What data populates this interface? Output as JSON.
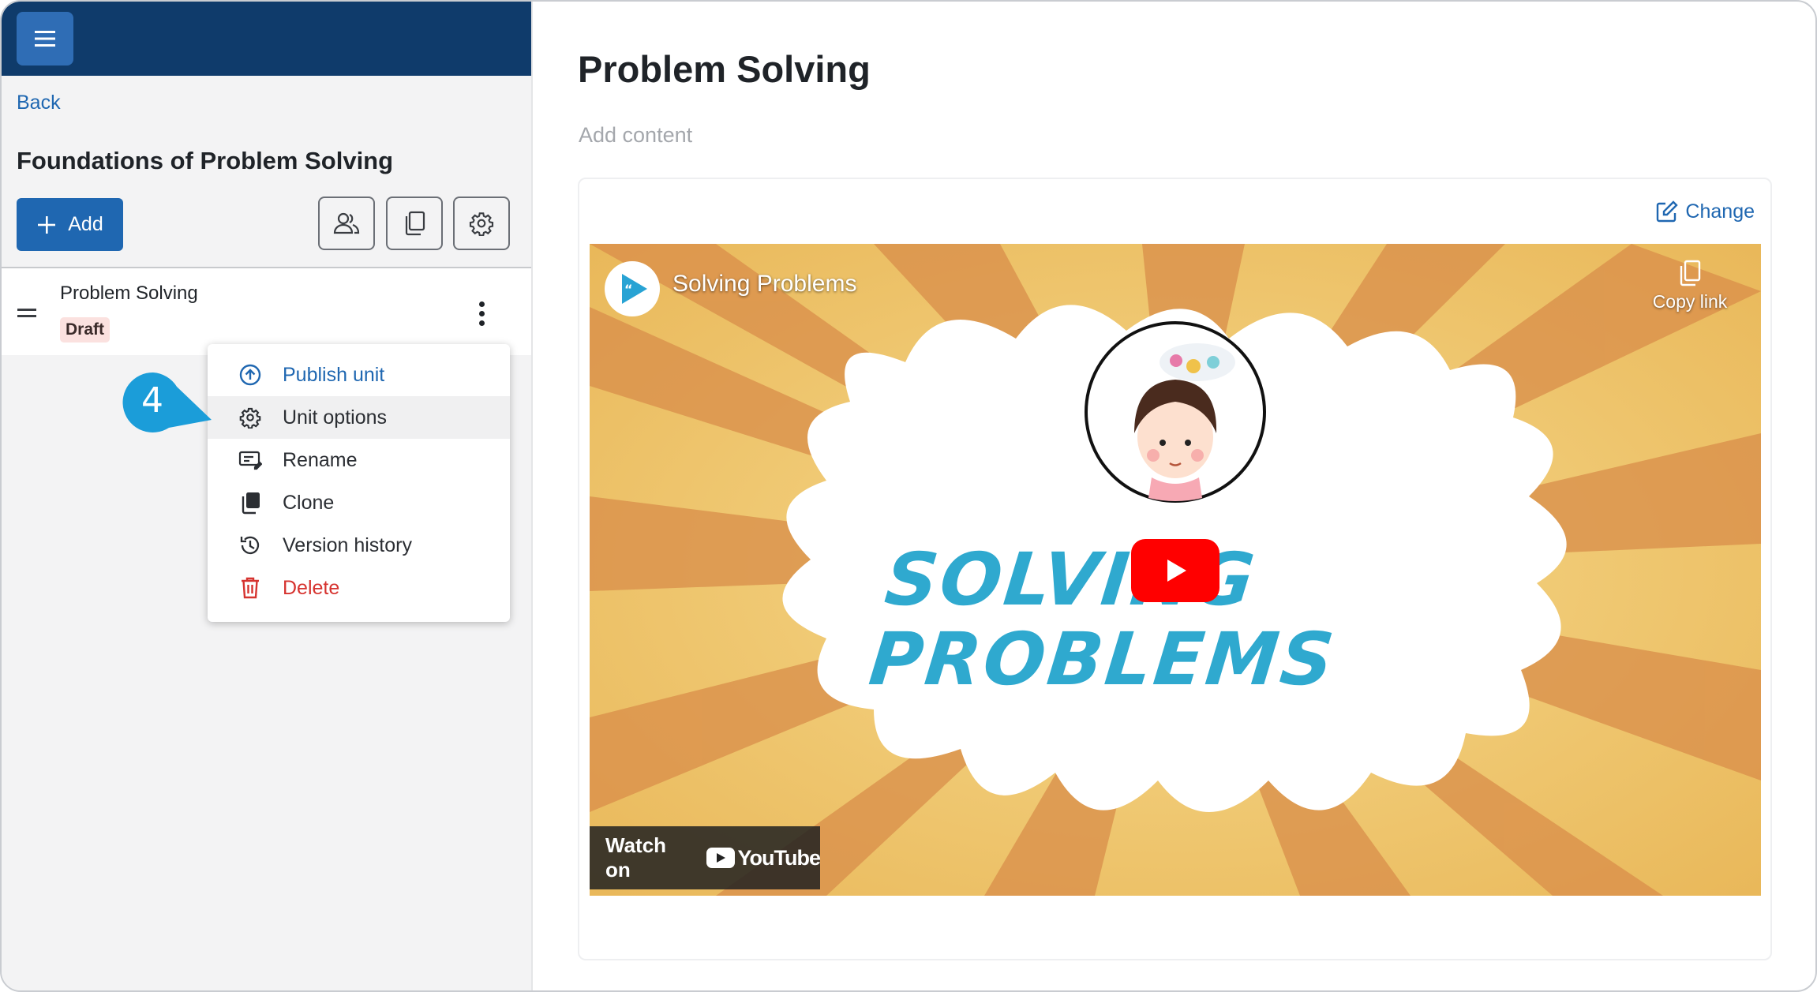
{
  "sidebar": {
    "back_label": "Back",
    "course_title": "Foundations of Problem Solving",
    "add_label": "Add",
    "tools": [
      {
        "icon": "users-icon"
      },
      {
        "icon": "copy-icon"
      },
      {
        "icon": "gear-icon"
      }
    ],
    "unit": {
      "name": "Problem Solving",
      "status": "Draft"
    }
  },
  "context_menu": {
    "items": [
      {
        "label": "Publish unit",
        "icon": "upload-circle-icon"
      },
      {
        "label": "Unit options",
        "icon": "gear-icon"
      },
      {
        "label": "Rename",
        "icon": "rename-icon"
      },
      {
        "label": "Clone",
        "icon": "clone-icon"
      },
      {
        "label": "Version history",
        "icon": "history-icon"
      },
      {
        "label": "Delete",
        "icon": "trash-icon"
      }
    ],
    "highlighted_index": 1
  },
  "callout": {
    "step": "4",
    "color": "#1b9dd9"
  },
  "main": {
    "title": "Problem Solving",
    "add_content": "Add content",
    "change_label": "Change",
    "video": {
      "title": "Solving Problems",
      "copy_link": "Copy link",
      "thumbnail_line1": "SOLVING",
      "thumbnail_line2": "PROBLEMS",
      "watch_on": "Watch on",
      "youtube": "YouTube"
    }
  },
  "colors": {
    "topbar": "#0f3b6b",
    "primary": "#1f67b1",
    "danger": "#d6332f",
    "draft_badge": "#fbe1df"
  }
}
